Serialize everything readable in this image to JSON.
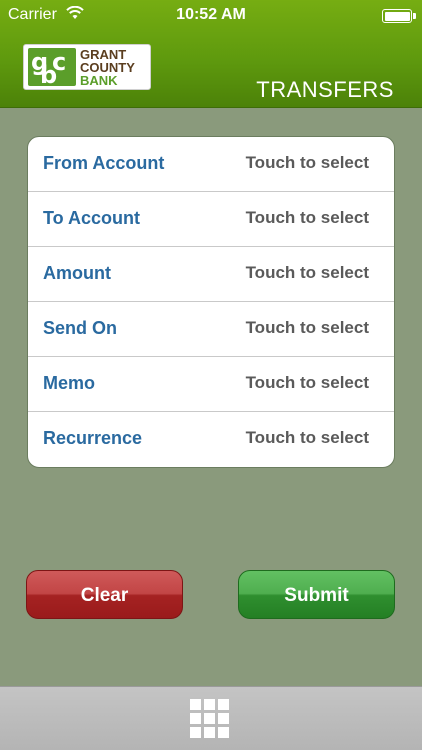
{
  "status_bar": {
    "carrier": "Carrier",
    "time": "10:52 AM",
    "wifi_icon": "wifi-icon",
    "battery_icon": "battery-icon",
    "battery_level": 1.0
  },
  "header": {
    "logo": {
      "mark": "gcb",
      "line1": "GRANT",
      "line2": "COUNTY",
      "line3": "BANK"
    },
    "title": "TRANSFERS"
  },
  "form": {
    "rows": [
      {
        "label": "From Account",
        "value": "Touch to select"
      },
      {
        "label": "To Account",
        "value": "Touch to select"
      },
      {
        "label": "Amount",
        "value": "Touch to select"
      },
      {
        "label": "Send On",
        "value": "Touch to select"
      },
      {
        "label": "Memo",
        "value": "Touch to select"
      },
      {
        "label": "Recurrence",
        "value": "Touch to select"
      }
    ]
  },
  "actions": {
    "clear_label": "Clear",
    "submit_label": "Submit"
  },
  "bottom_bar": {
    "menu_icon": "grid-menu-icon"
  },
  "colors": {
    "header_green": "#5f9a0e",
    "background": "#8a9a7c",
    "label_blue": "#2a6aa0",
    "clear_red": "#b02e2e",
    "submit_green": "#3a9a3a"
  }
}
